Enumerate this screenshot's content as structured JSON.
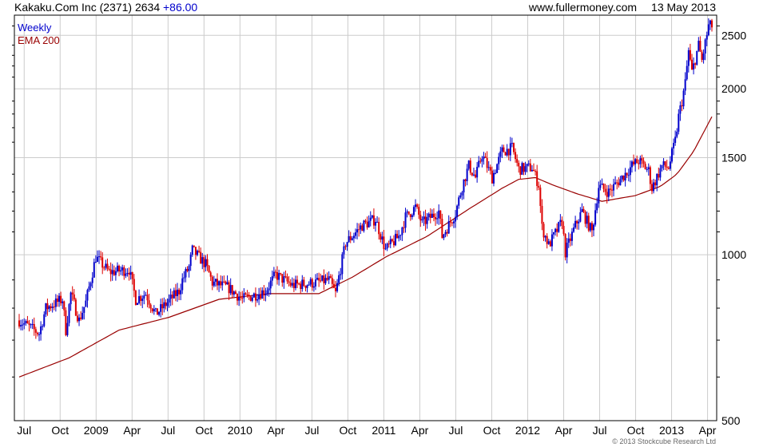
{
  "header": {
    "left_text": "Kakaku.Com Inc (2371) 2634",
    "change": "+86.00",
    "site": "www.fullermoney.com",
    "date": "13 May 2013"
  },
  "copyright": "© 2013 Stockcube Research Ltd",
  "colors": {
    "up": "#0000cc",
    "down": "#dd0000",
    "ema": "#990000",
    "grid": "#cccccc",
    "frame": "#000000"
  },
  "chart_data": {
    "type": "candlestick",
    "legend": [
      "Weekly",
      "EMA 200"
    ],
    "y_scale": "log",
    "ylim": [
      500,
      2720
    ],
    "y_ticks": [
      500,
      1000,
      1500,
      2000,
      2500
    ],
    "x_ticks": [
      "Jul",
      "Oct",
      "2009",
      "Apr",
      "Jul",
      "Oct",
      "2010",
      "Apr",
      "Jul",
      "Oct",
      "2011",
      "Apr",
      "Jul",
      "Oct",
      "2012",
      "Apr",
      "Jul",
      "Oct",
      "2013",
      "Apr"
    ],
    "price_path_approx": [
      [
        0,
        760
      ],
      [
        12,
        720
      ],
      [
        16,
        800
      ],
      [
        26,
        830
      ],
      [
        28,
        730
      ],
      [
        31,
        850
      ],
      [
        36,
        760
      ],
      [
        40,
        820
      ],
      [
        46,
        990
      ],
      [
        54,
        930
      ],
      [
        66,
        940
      ],
      [
        70,
        830
      ],
      [
        76,
        850
      ],
      [
        82,
        780
      ],
      [
        96,
        860
      ],
      [
        98,
        900
      ],
      [
        102,
        950
      ],
      [
        104,
        1020
      ],
      [
        112,
        960
      ],
      [
        116,
        890
      ],
      [
        126,
        870
      ],
      [
        134,
        830
      ],
      [
        148,
        860
      ],
      [
        154,
        920
      ],
      [
        164,
        880
      ],
      [
        178,
        890
      ],
      [
        186,
        900
      ],
      [
        190,
        850
      ],
      [
        196,
        1050
      ],
      [
        206,
        1130
      ],
      [
        214,
        1160
      ],
      [
        220,
        1020
      ],
      [
        228,
        1080
      ],
      [
        232,
        1170
      ],
      [
        238,
        1220
      ],
      [
        242,
        1140
      ],
      [
        252,
        1200
      ],
      [
        254,
        1080
      ],
      [
        262,
        1190
      ],
      [
        266,
        1330
      ],
      [
        270,
        1450
      ],
      [
        274,
        1380
      ],
      [
        278,
        1520
      ],
      [
        284,
        1380
      ],
      [
        290,
        1540
      ],
      [
        296,
        1560
      ],
      [
        300,
        1430
      ],
      [
        308,
        1440
      ],
      [
        312,
        1340
      ],
      [
        314,
        1120
      ],
      [
        318,
        1040
      ],
      [
        326,
        1150
      ],
      [
        328,
        1010
      ],
      [
        334,
        1130
      ],
      [
        338,
        1200
      ],
      [
        344,
        1100
      ],
      [
        348,
        1330
      ],
      [
        354,
        1300
      ],
      [
        362,
        1380
      ],
      [
        368,
        1450
      ],
      [
        372,
        1480
      ],
      [
        378,
        1420
      ],
      [
        380,
        1320
      ],
      [
        386,
        1450
      ],
      [
        390,
        1440
      ],
      [
        394,
        1610
      ],
      [
        396,
        1780
      ],
      [
        398,
        1900
      ],
      [
        400,
        2050
      ],
      [
        402,
        2340
      ],
      [
        404,
        2140
      ],
      [
        408,
        2400
      ],
      [
        410,
        2250
      ],
      [
        414,
        2600
      ],
      [
        416,
        2600
      ]
    ],
    "ema_path_approx": [
      [
        0,
        600
      ],
      [
        30,
        650
      ],
      [
        60,
        730
      ],
      [
        90,
        770
      ],
      [
        120,
        830
      ],
      [
        150,
        850
      ],
      [
        180,
        850
      ],
      [
        200,
        910
      ],
      [
        220,
        990
      ],
      [
        245,
        1080
      ],
      [
        270,
        1210
      ],
      [
        290,
        1320
      ],
      [
        300,
        1370
      ],
      [
        310,
        1380
      ],
      [
        320,
        1340
      ],
      [
        335,
        1290
      ],
      [
        350,
        1250
      ],
      [
        370,
        1280
      ],
      [
        385,
        1330
      ],
      [
        395,
        1400
      ],
      [
        405,
        1540
      ],
      [
        416,
        1780
      ]
    ]
  }
}
